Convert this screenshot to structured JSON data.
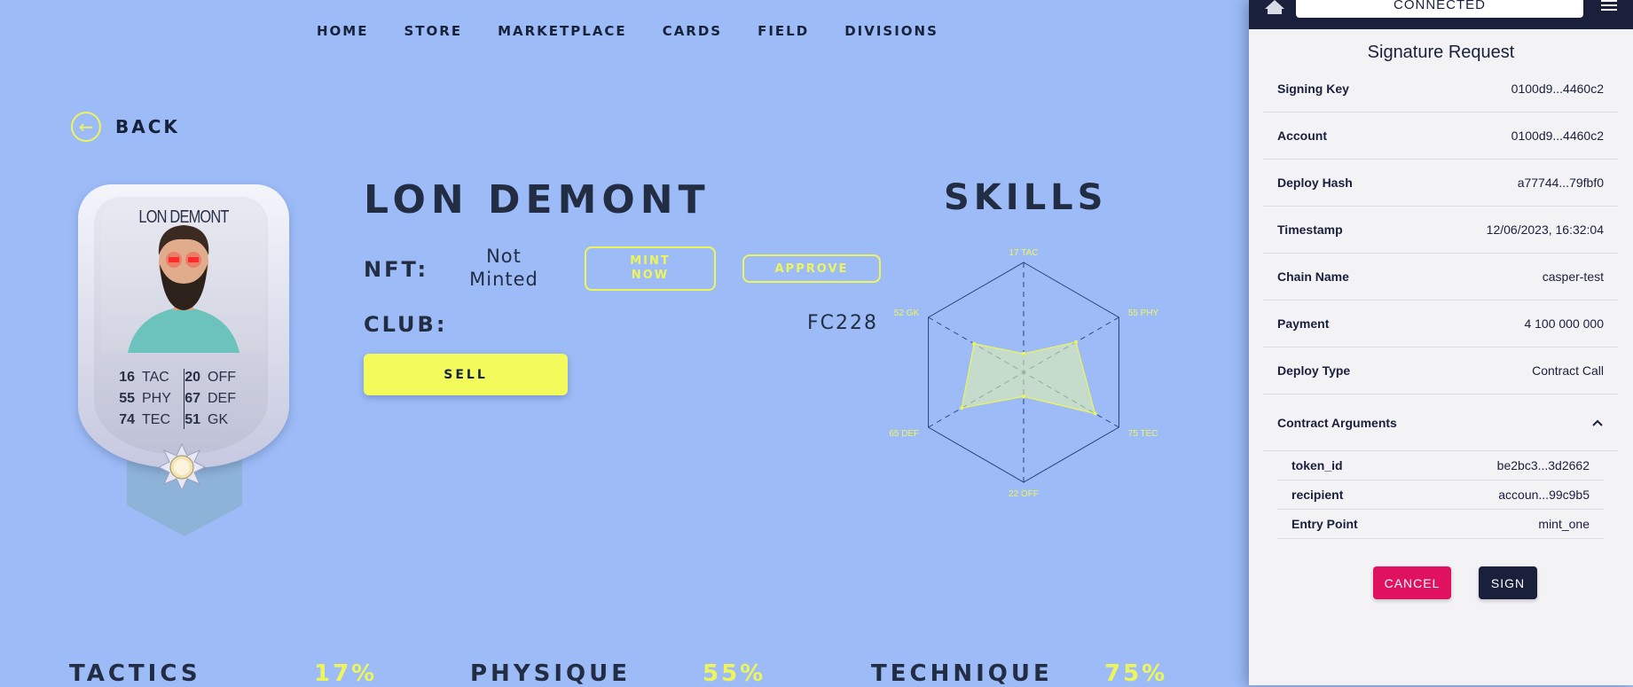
{
  "nav": {
    "items": [
      "HOME",
      "STORE",
      "MARKETPLACE",
      "CARDS",
      "FIELD",
      "DIVISIONS"
    ]
  },
  "back": {
    "label": "BACK"
  },
  "card": {
    "name": "LON DEMONT",
    "stats": [
      {
        "value": "16",
        "key": "TAC",
        "value2": "20",
        "key2": "OFF"
      },
      {
        "value": "55",
        "key": "PHY",
        "value2": "67",
        "key2": "DEF"
      },
      {
        "value": "74",
        "key": "TEC",
        "value2": "51",
        "key2": "GK"
      }
    ]
  },
  "player": {
    "name": "LON DEMONT",
    "nft_label": "NFT:",
    "nft_status_line1": "Not",
    "nft_status_line2": "Minted",
    "mint_line1": "MINT",
    "mint_line2": "NOW",
    "approve": "APPROVE",
    "club_label": "CLUB:",
    "club_value": "FC228",
    "sell": "SELL"
  },
  "skills": {
    "title": "SKILLS",
    "axes": [
      {
        "label": "17 TAC",
        "value": 17
      },
      {
        "label": "55 PHY",
        "value": 55
      },
      {
        "label": "75 TEC",
        "value": 75
      },
      {
        "label": "22 OFF",
        "value": 22
      },
      {
        "label": "65 DEF",
        "value": 65
      },
      {
        "label": "52 GK",
        "value": 52
      }
    ]
  },
  "bottom": [
    {
      "label": "TACTICS",
      "pct": "17%"
    },
    {
      "label": "PHYSIQUE",
      "pct": "55%"
    },
    {
      "label": "TECHNIQUE",
      "pct": "75%"
    }
  ],
  "wallet": {
    "status": "CONNECTED",
    "title": "Signature Request",
    "rows": [
      {
        "key": "Signing Key",
        "value": "0100d9...4460c2"
      },
      {
        "key": "Account",
        "value": "0100d9...4460c2"
      },
      {
        "key": "Deploy Hash",
        "value": "a77744...79fbf0"
      },
      {
        "key": "Timestamp",
        "value": "12/06/2023, 16:32:04"
      },
      {
        "key": "Chain Name",
        "value": "casper-test"
      },
      {
        "key": "Payment",
        "value": "4 100 000 000"
      },
      {
        "key": "Deploy Type",
        "value": "Contract Call"
      }
    ],
    "args_title": "Contract Arguments",
    "args": [
      {
        "key": "token_id",
        "value": "be2bc3...3d2662"
      },
      {
        "key": "recipient",
        "value": "accoun...99c9b5"
      },
      {
        "key": "Entry Point",
        "value": "mint_one"
      }
    ],
    "cancel": "CANCEL",
    "sign": "SIGN"
  },
  "colors": {
    "background": "#9dbcf7",
    "accent": "#eef55a",
    "navy": "#1a1f3c",
    "cancel": "#e0115f"
  }
}
